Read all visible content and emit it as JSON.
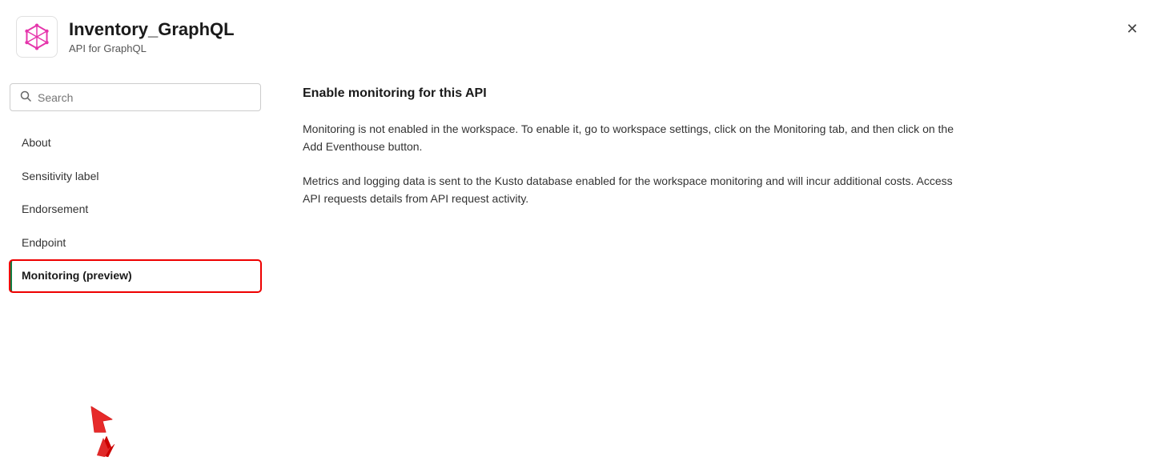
{
  "header": {
    "title": "Inventory_GraphQL",
    "subtitle": "API for GraphQL",
    "close_label": "✕"
  },
  "sidebar": {
    "search_placeholder": "Search",
    "nav_items": [
      {
        "id": "about",
        "label": "About",
        "active": false
      },
      {
        "id": "sensitivity-label",
        "label": "Sensitivity label",
        "active": false
      },
      {
        "id": "endorsement",
        "label": "Endorsement",
        "active": false
      },
      {
        "id": "endpoint",
        "label": "Endpoint",
        "active": false
      },
      {
        "id": "monitoring-preview",
        "label": "Monitoring (preview)",
        "active": true
      }
    ]
  },
  "main": {
    "title": "Enable monitoring for this API",
    "paragraphs": [
      "Monitoring is not enabled in the workspace. To enable it, go to workspace settings, click on the Monitoring tab, and then click on the Add Eventhouse button.",
      "Metrics and logging data is sent to the Kusto database enabled for the workspace monitoring and will incur additional costs. Access API requests details from API request activity."
    ]
  }
}
